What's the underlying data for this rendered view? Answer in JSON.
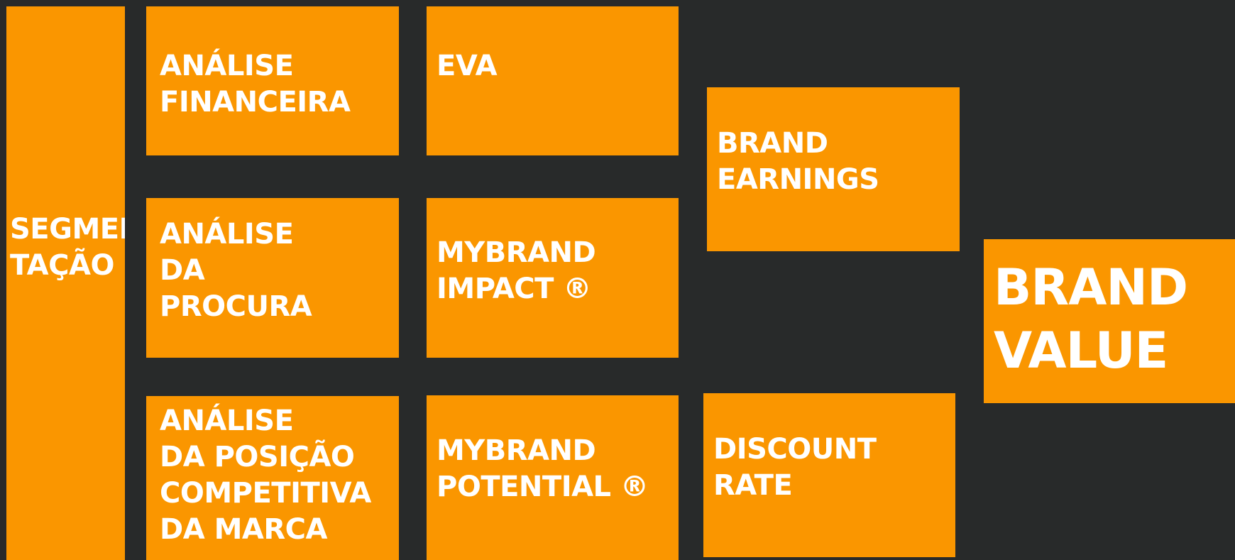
{
  "diagram": {
    "blocks": {
      "segmentacao": [
        "SEGMEN",
        "TAÇÃO"
      ],
      "analise_financeira": [
        "ANÁLISE",
        "FINANCEIRA"
      ],
      "eva": [
        "EVA"
      ],
      "analise_procura": [
        "ANÁLISE",
        "DA",
        "PROCURA"
      ],
      "mybrand_impact": [
        "MYBRAND",
        "IMPACT ®"
      ],
      "analise_posicao": [
        "ANÁLISE",
        "DA POSIÇÃO",
        "COMPETITIVA",
        "DA MARCA"
      ],
      "mybrand_potential": [
        "MYBRAND",
        "POTENTIAL ®"
      ],
      "brand_earnings": [
        "BRAND",
        "EARNINGS"
      ],
      "discount_rate": [
        "DISCOUNT",
        "RATE"
      ],
      "brand_value": [
        "BRAND",
        "VALUE"
      ]
    },
    "colors": {
      "background": "#282a2a",
      "block": "#fa9600",
      "text": "#ffffff"
    }
  }
}
